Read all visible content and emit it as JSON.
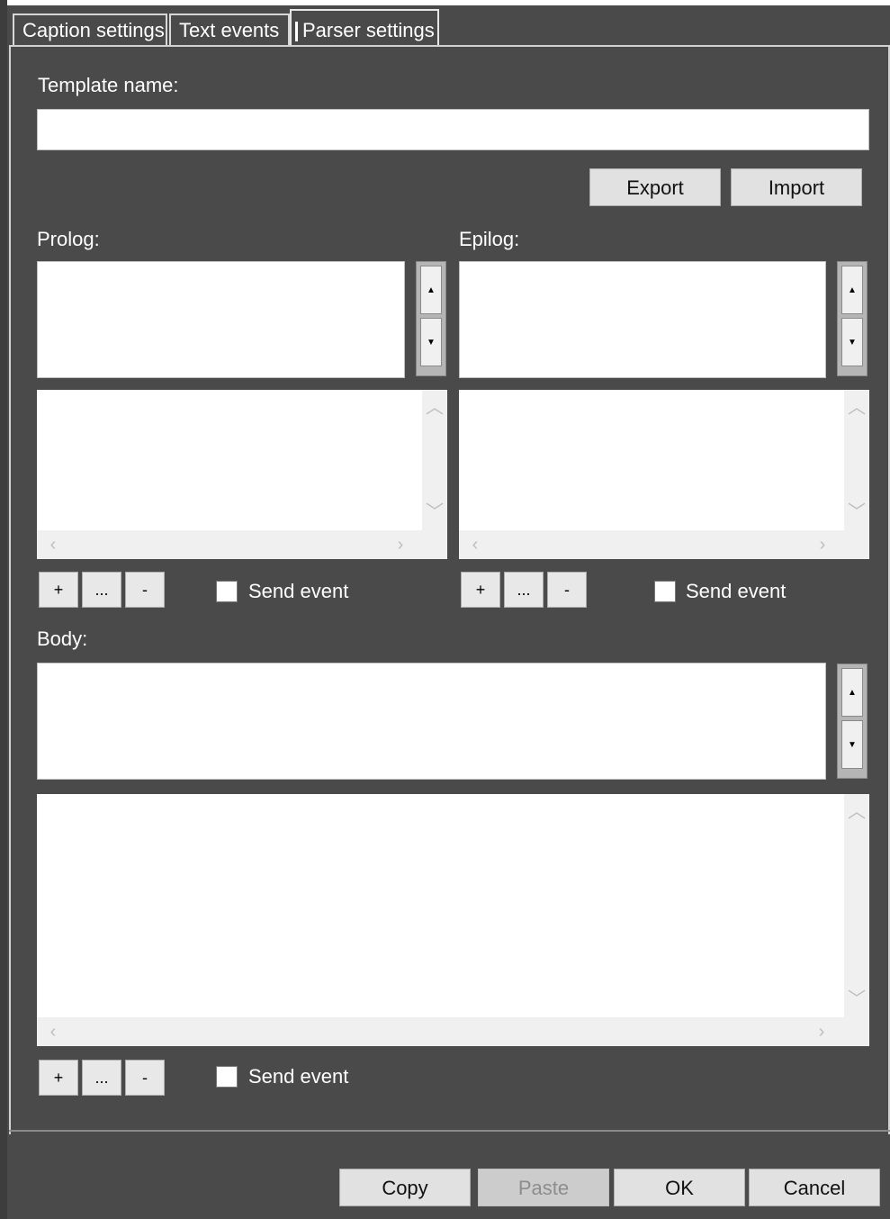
{
  "tabs": [
    {
      "label": "Caption settings"
    },
    {
      "label": "Text events"
    },
    {
      "label": "Parser settings"
    }
  ],
  "template": {
    "label": "Template name:",
    "value": ""
  },
  "export_label": "Export",
  "import_label": "Import",
  "prolog": {
    "label": "Prolog:",
    "add_label": "+",
    "edit_label": "...",
    "remove_label": "-",
    "send_event_label": "Send event",
    "send_event_checked": false
  },
  "epilog": {
    "label": "Epilog:",
    "add_label": "+",
    "edit_label": "...",
    "remove_label": "-",
    "send_event_label": "Send event",
    "send_event_checked": false
  },
  "body_section": {
    "label": "Body:",
    "add_label": "+",
    "edit_label": "...",
    "remove_label": "-",
    "send_event_label": "Send event",
    "send_event_checked": false
  },
  "footer": {
    "copy_label": "Copy",
    "paste_label": "Paste",
    "ok_label": "OK",
    "cancel_label": "Cancel"
  },
  "icons": {
    "spin_up": "caret-up-icon",
    "spin_down": "caret-down-icon",
    "scroll_up": "chevron-up-icon",
    "scroll_down": "chevron-down-icon",
    "scroll_left": "chevron-left-icon",
    "scroll_right": "chevron-right-icon"
  },
  "colors": {
    "background": "#4a4a4a",
    "field": "#ffffff",
    "button": "#e1e1e1",
    "text": "#ffffff"
  }
}
